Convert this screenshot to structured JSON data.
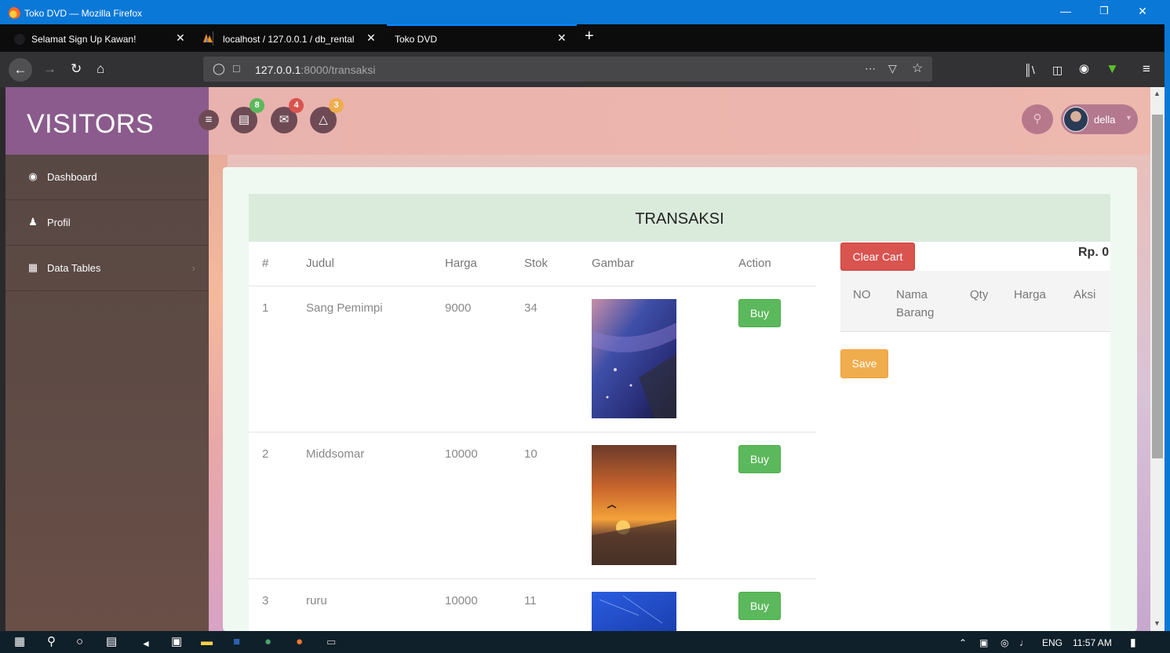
{
  "window": {
    "title": "Toko DVD — Mozilla Firefox"
  },
  "tabs": [
    {
      "label": "Selamat Sign Up Kawan!"
    },
    {
      "label": "localhost / 127.0.0.1 / db_rental"
    },
    {
      "label": "Toko DVD"
    }
  ],
  "address": {
    "host": "127.0.0.1",
    "path": ":8000/transaksi"
  },
  "app": {
    "brand": "VISITORS",
    "badges": {
      "tasks": "8",
      "messages": "4",
      "notifications": "3"
    },
    "badge_colors": {
      "tasks": "#5cb85c",
      "messages": "#d9534f",
      "notifications": "#f0ad4e"
    },
    "user": "della"
  },
  "sidebar": {
    "items": [
      {
        "label": "Dashboard",
        "icon": "dashboard-icon"
      },
      {
        "label": "Profil",
        "icon": "user-icon"
      },
      {
        "label": "Data Tables",
        "icon": "table-icon"
      }
    ]
  },
  "transaksi": {
    "title": "TRANSAKSI",
    "columns": {
      "num": "#",
      "judul": "Judul",
      "harga": "Harga",
      "stok": "Stok",
      "gambar": "Gambar",
      "action": "Action"
    },
    "rows": [
      {
        "no": "1",
        "judul": "Sang Pemimpi",
        "harga": "9000",
        "stok": "34",
        "button": "Buy"
      },
      {
        "no": "2",
        "judul": "Middsomar",
        "harga": "10000",
        "stok": "10",
        "button": "Buy"
      },
      {
        "no": "3",
        "judul": "ruru",
        "harga": "10000",
        "stok": "11",
        "button": "Buy"
      }
    ]
  },
  "cart": {
    "clear_label": "Clear Cart",
    "total": "Rp. 0",
    "columns": {
      "no": "NO",
      "nama": "Nama Barang",
      "qty": "Qty",
      "harga": "Harga",
      "aksi": "Aksi"
    },
    "save_label": "Save"
  },
  "taskbar": {
    "lang": "ENG",
    "time": "11:57 AM"
  },
  "colors": {
    "buy": "#5cb85c",
    "clear": "#d9534f",
    "save": "#f0ad4e",
    "firefox_blue": "#0a78d7"
  }
}
